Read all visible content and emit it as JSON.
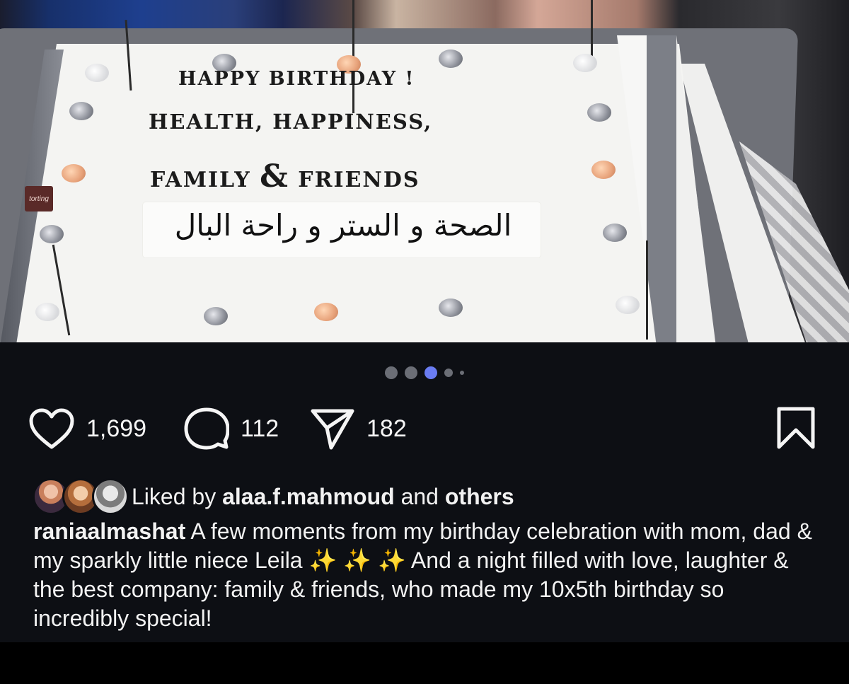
{
  "photo": {
    "cake_line1": "HAPPY  BIRTHDAY !",
    "cake_line2": "HEALTH, HAPPINESS,",
    "cake_line3_a": "FAMILY",
    "cake_line3_amp": "&",
    "cake_line3_b": "FRIENDS",
    "cake_arabic": "الصحة و الستر و راحة البال",
    "tag_text": "torting"
  },
  "carousel": {
    "total_dots": 5,
    "active_index": 2
  },
  "actions": {
    "like_count": "1,699",
    "comment_count": "112",
    "share_count": "182"
  },
  "likes": {
    "prefix": "Liked by",
    "user": "alaa.f.mahmoud",
    "middle": "and",
    "suffix": "others"
  },
  "caption": {
    "username": "raniaalmashat",
    "text": "A few moments from my birthday celebration with mom, dad & my sparkly little niece Leila ✨ ✨ ✨ And a night filled with love, laughter & the best company: family & friends, who made my 10x5th birthday so incredibly special!"
  },
  "colors": {
    "background": "#0d0f14",
    "accent_dot": "#6a7cf2",
    "text": "#f2f2f2"
  }
}
